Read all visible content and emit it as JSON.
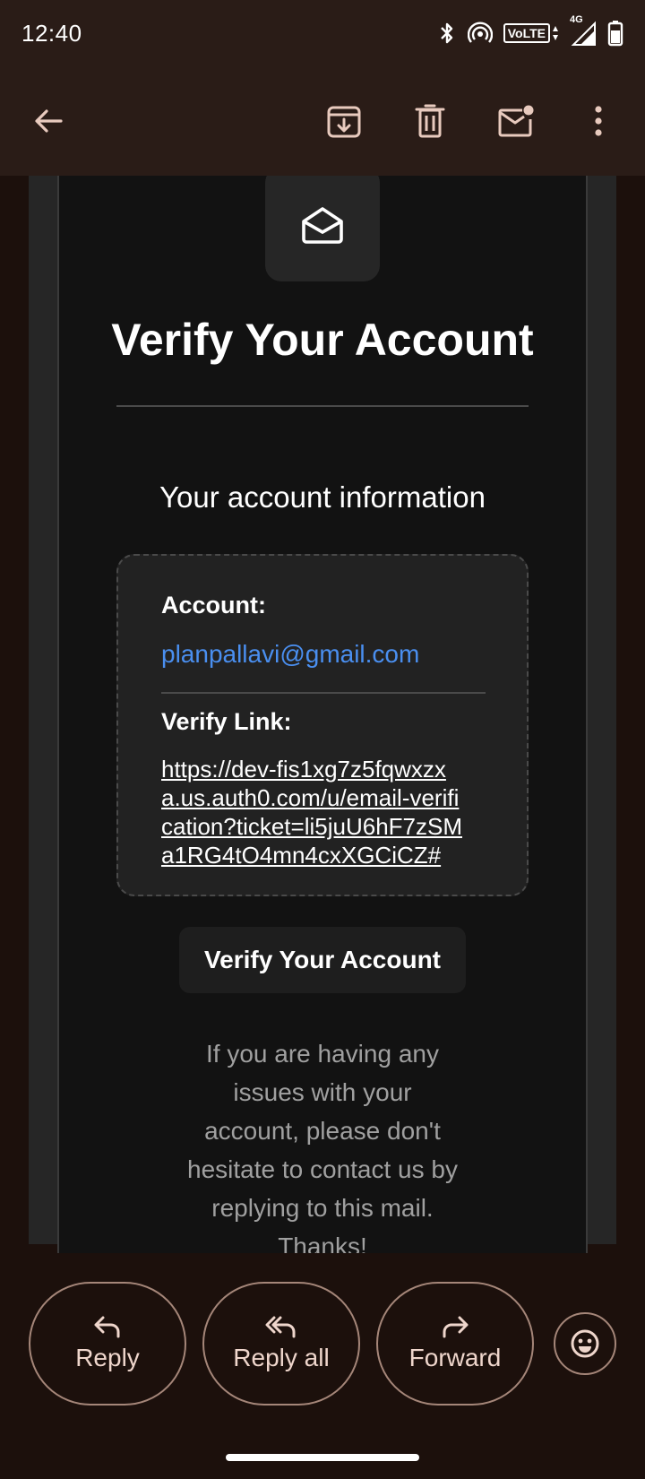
{
  "status_bar": {
    "time": "12:40",
    "network": "4G",
    "volte": "VoLTE",
    "icons": [
      "bluetooth-icon",
      "hotspot-icon",
      "volte-icon",
      "signal-icon",
      "battery-icon"
    ]
  },
  "toolbar": {
    "icons": [
      "back-arrow-icon",
      "archive-icon",
      "delete-icon",
      "mark-unread-icon",
      "more-options-icon"
    ]
  },
  "email": {
    "logo_icon": "open-envelope-icon",
    "heading": "Verify Your Account",
    "subheading": "Your account information",
    "account_label": "Account:",
    "account_email": "planpallavi@gmail.com",
    "verify_link_label": "Verify Link:",
    "verify_link_lines": [
      "https://dev-fis1xg7z5fqwxzx",
      "a.us.auth0.com/u/email-verifi",
      "cation?ticket=li5juU6hF7zSM",
      "a1RG4tO4mn4cxXGCiCZ#"
    ],
    "verify_button": "Verify Your Account",
    "footer_lines": [
      "If you are having any",
      "issues with your",
      "account, please don't",
      "hesitate to contact us by",
      "replying to this mail.",
      "Thanks!"
    ]
  },
  "actions": {
    "reply": "Reply",
    "reply_all": "Reply all",
    "forward": "Forward",
    "emoji_icon": "emoji-react-icon"
  },
  "colors": {
    "app_background": "#1c100c",
    "toolbar_background": "#2a1c17",
    "email_card": "#121212",
    "link_blue": "#4a8ff0",
    "action_text": "#efd6cc",
    "action_border": "#a58679"
  }
}
